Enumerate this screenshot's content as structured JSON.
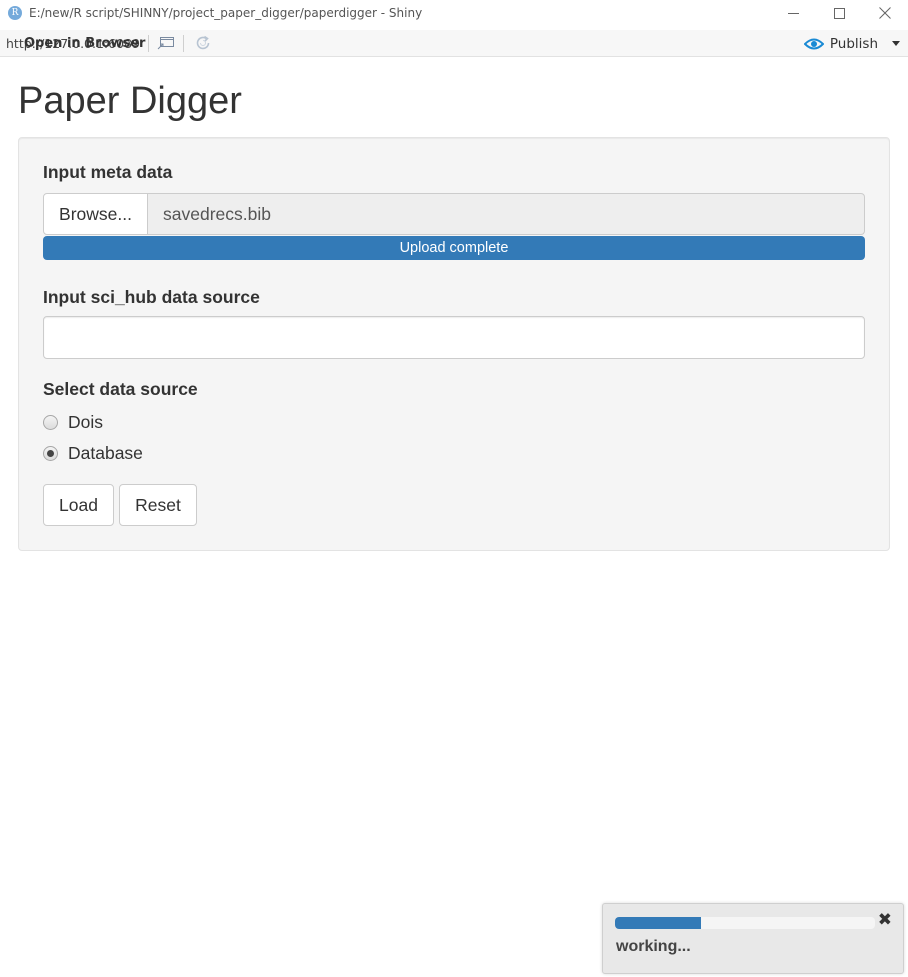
{
  "window": {
    "app_icon_letter": "R",
    "title": "E:/new/R script/SHINNY/project_paper_digger/paperdigger - Shiny"
  },
  "toolbar": {
    "url": "http://127.0.0.1:6089",
    "open_in_browser": "Open in Browser",
    "publish": "Publish"
  },
  "page": {
    "title": "Paper Digger"
  },
  "form": {
    "meta_label": "Input meta data",
    "browse_label": "Browse...",
    "file_name": "savedrecs.bib",
    "upload_status": "Upload complete",
    "upload_progress": 1.0,
    "scihub_label": "Input sci_hub data source",
    "scihub_value": "",
    "source_label": "Select data source",
    "source_options": [
      {
        "label": "Dois",
        "checked": false
      },
      {
        "label": "Database",
        "checked": true
      }
    ],
    "load_label": "Load",
    "reset_label": "Reset"
  },
  "notification": {
    "message": "working...",
    "close_symbol": "✖",
    "progress": 0.33
  },
  "colors": {
    "accent": "#337ab7",
    "publish_icon": "#1a8ad4",
    "well_bg": "#f5f5f5"
  },
  "icons": {
    "window_minimize": "minimize-icon",
    "window_maximize": "maximize-icon",
    "window_close": "close-icon",
    "open_in_browser": "open-in-browser-icon",
    "refresh": "refresh-icon",
    "publish": "publish-icon"
  }
}
